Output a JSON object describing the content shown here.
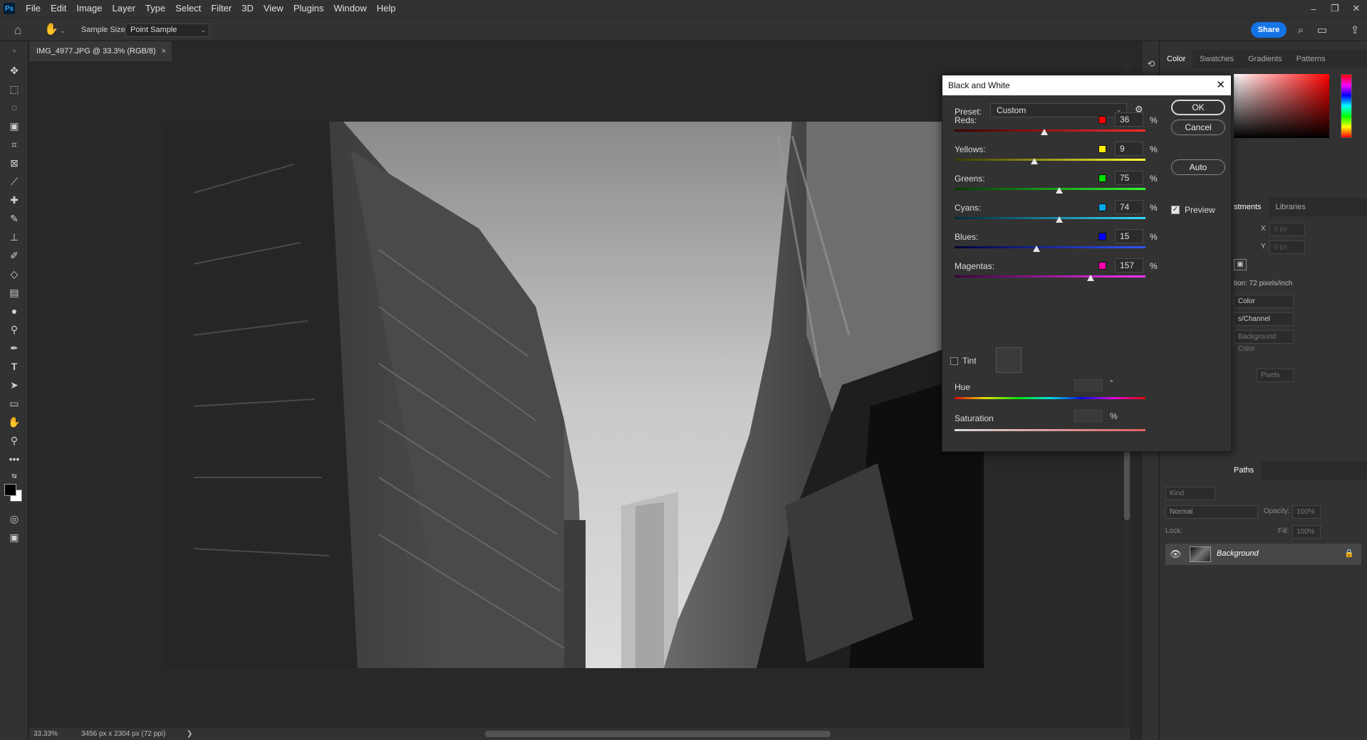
{
  "menubar": {
    "logo": "Ps",
    "items": [
      "File",
      "Edit",
      "Image",
      "Layer",
      "Type",
      "Select",
      "Filter",
      "3D",
      "View",
      "Plugins",
      "Window",
      "Help"
    ],
    "window_controls": [
      "–",
      "❐",
      "✕"
    ]
  },
  "options_bar": {
    "sample_size_label": "Sample Size:",
    "sample_size_value": "Point Sample",
    "share_label": "Share"
  },
  "document": {
    "tab_title": "IMG_4977.JPG @ 33.3% (RGB/8)",
    "close_glyph": "×"
  },
  "status_bar": {
    "zoom": "33.33%",
    "doc_info": "3456 px x 2304 px (72 ppi)",
    "arrow": "❯"
  },
  "panels": {
    "color_tabs": [
      "Color",
      "Swatches",
      "Gradients",
      "Patterns"
    ],
    "props_tabs": [
      "stments",
      "Libraries"
    ],
    "props": {
      "x_label": "X",
      "y_label": "Y",
      "x_value": "0 px",
      "y_value": "0 px",
      "resolution": "tion: 72 pixels/inch",
      "mode": "Color",
      "channel": "s/Channel",
      "bg_color": "Background Color",
      "units": "Pixels"
    },
    "layers_tabs": [
      "Paths"
    ],
    "layers": {
      "kind_placeholder": "Kind",
      "blend_mode": "Normal",
      "opacity_label": "Opacity:",
      "opacity_value": "100%",
      "lock_label": "Lock:",
      "fill_label": "Fill:",
      "fill_value": "100%",
      "layer_name": "Background"
    }
  },
  "dialog": {
    "title": "Black and White",
    "preset_label": "Preset:",
    "preset_value": "Custom",
    "channels": [
      {
        "label": "Reds:",
        "value": "36",
        "pct": 36,
        "swatch": "#ff0000",
        "track_from": "#3a0000",
        "track_to": "#ff2a2a"
      },
      {
        "label": "Yellows:",
        "value": "9",
        "pct": 9,
        "swatch": "#ffee00",
        "track_from": "#3a3a00",
        "track_to": "#ffff33"
      },
      {
        "label": "Greens:",
        "value": "75",
        "pct": 75,
        "swatch": "#00e000",
        "track_from": "#003a00",
        "track_to": "#33ff33"
      },
      {
        "label": "Cyans:",
        "value": "74",
        "pct": 74,
        "swatch": "#00a8e8",
        "track_from": "#002a3a",
        "track_to": "#33ddff"
      },
      {
        "label": "Blues:",
        "value": "15",
        "pct": 15,
        "swatch": "#0000ff",
        "track_from": "#00003a",
        "track_to": "#3355ff"
      },
      {
        "label": "Magentas:",
        "value": "157",
        "pct": 157,
        "swatch": "#ff00aa",
        "track_from": "#3a003a",
        "track_to": "#ff33ff"
      }
    ],
    "pct_symbol": "%",
    "tint_label": "Tint",
    "hue_label": "Hue",
    "hue_unit": "°",
    "saturation_label": "Saturation",
    "saturation_unit": "%",
    "ok_label": "OK",
    "cancel_label": "Cancel",
    "auto_label": "Auto",
    "preview_label": "Preview",
    "preview_checked": true
  }
}
